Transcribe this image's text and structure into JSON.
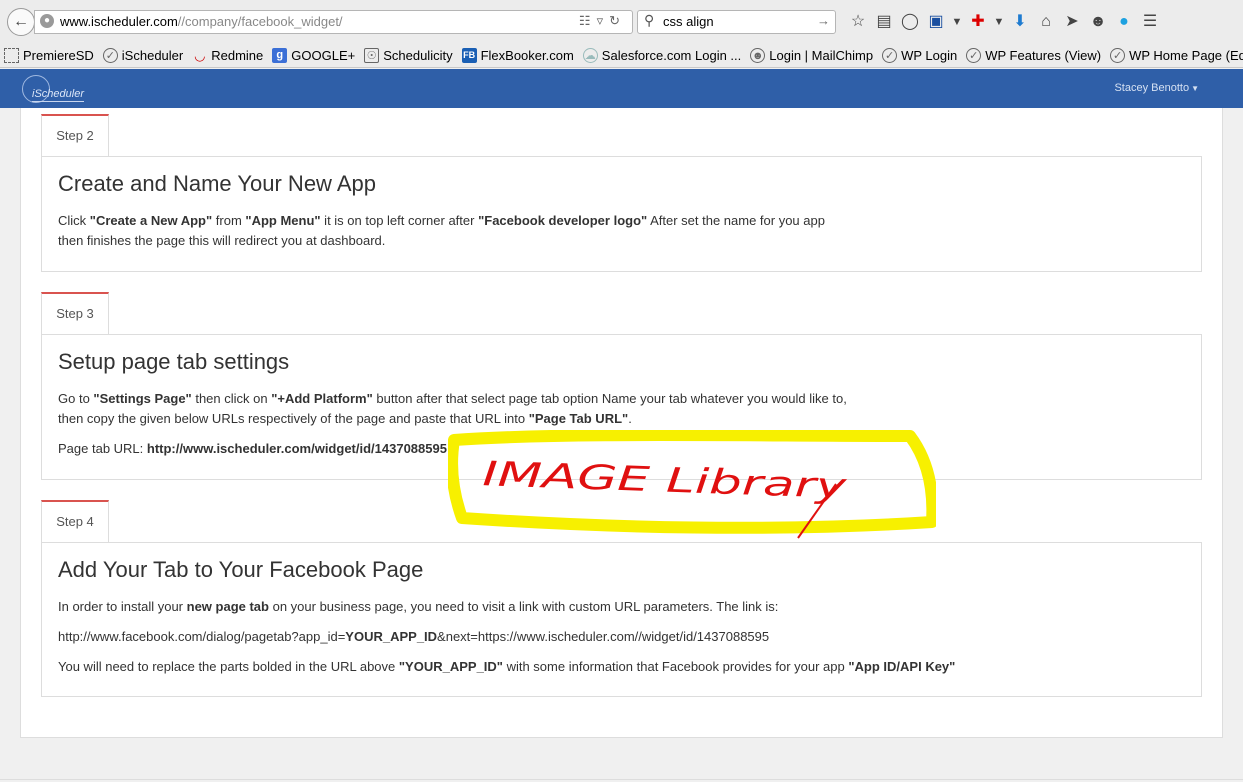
{
  "browser": {
    "url_host": "www.ischeduler.com",
    "url_path": "//company/facebook_widget/",
    "search_value": "css align",
    "bookmarks": [
      {
        "label": "PremiereSD",
        "icon": "page-icon"
      },
      {
        "label": "iScheduler",
        "icon": "gauge-icon"
      },
      {
        "label": "Redmine",
        "icon": "redmine-icon"
      },
      {
        "label": "GOOGLE+",
        "icon": "google-icon"
      },
      {
        "label": "Schedulicity",
        "icon": "schedulicity-icon"
      },
      {
        "label": "FlexBooker.com",
        "icon": "fb-icon"
      },
      {
        "label": "Salesforce.com Login ...",
        "icon": "cloud-icon"
      },
      {
        "label": "Login | MailChimp",
        "icon": "mailchimp-icon"
      },
      {
        "label": "WP Login",
        "icon": "gauge-icon"
      },
      {
        "label": "WP Features (View)",
        "icon": "gauge-icon"
      },
      {
        "label": "WP Home Page (Edit)",
        "icon": "gauge-icon"
      }
    ]
  },
  "app": {
    "brand": "iScheduler",
    "user_name": "Stacey Benotto"
  },
  "steps": [
    {
      "tab": "Step 2",
      "title": "Create and Name Your New App",
      "line1_a": "Click ",
      "line1_b": "\"Create a New App\"",
      "line1_c": " from ",
      "line1_d": "\"App Menu\"",
      "line1_e": " it is on top left corner after ",
      "line1_f": "\"Facebook developer logo\"",
      "line1_g": " After set the name for you app",
      "line2": "then finishes the page this will redirect you at dashboard."
    },
    {
      "tab": "Step 3",
      "title": "Setup page tab settings",
      "line1_a": "Go to ",
      "line1_b": "\"Settings Page\"",
      "line1_c": " then click on ",
      "line1_d": "\"+Add Platform\"",
      "line1_e": " button after that select page tab option Name your tab whatever you would like to,",
      "line2_a": "then copy the given below URLs respectively of the page and paste that URL into ",
      "line2_b": "\"Page Tab URL\"",
      "line2_c": ".",
      "url_label": "Page tab URL: ",
      "url_value": "http://www.ischeduler.com/widget/id/1437088595"
    },
    {
      "tab": "Step 4",
      "title": "Add Your Tab to Your Facebook Page",
      "line1_a": "In order to install your ",
      "line1_b": "new page tab",
      "line1_c": " on your business page, you need to visit a link with custom URL parameters. The link is:",
      "link_a": "http://www.facebook.com/dialog/pagetab?app_id=",
      "link_b": "YOUR_APP_ID",
      "link_c": "&next=https://www.ischeduler.com//widget/id/1437088595",
      "line3_a": "You will need to replace the parts bolded in the URL above ",
      "line3_b": "\"YOUR_APP_ID\"",
      "line3_c": " with some information that Facebook provides for your app ",
      "line3_d": "\"App ID/API Key\""
    }
  ],
  "annotation": {
    "text": "IMAGE Library",
    "highlight_color": "#f7f000",
    "ink_color": "#e01010"
  }
}
